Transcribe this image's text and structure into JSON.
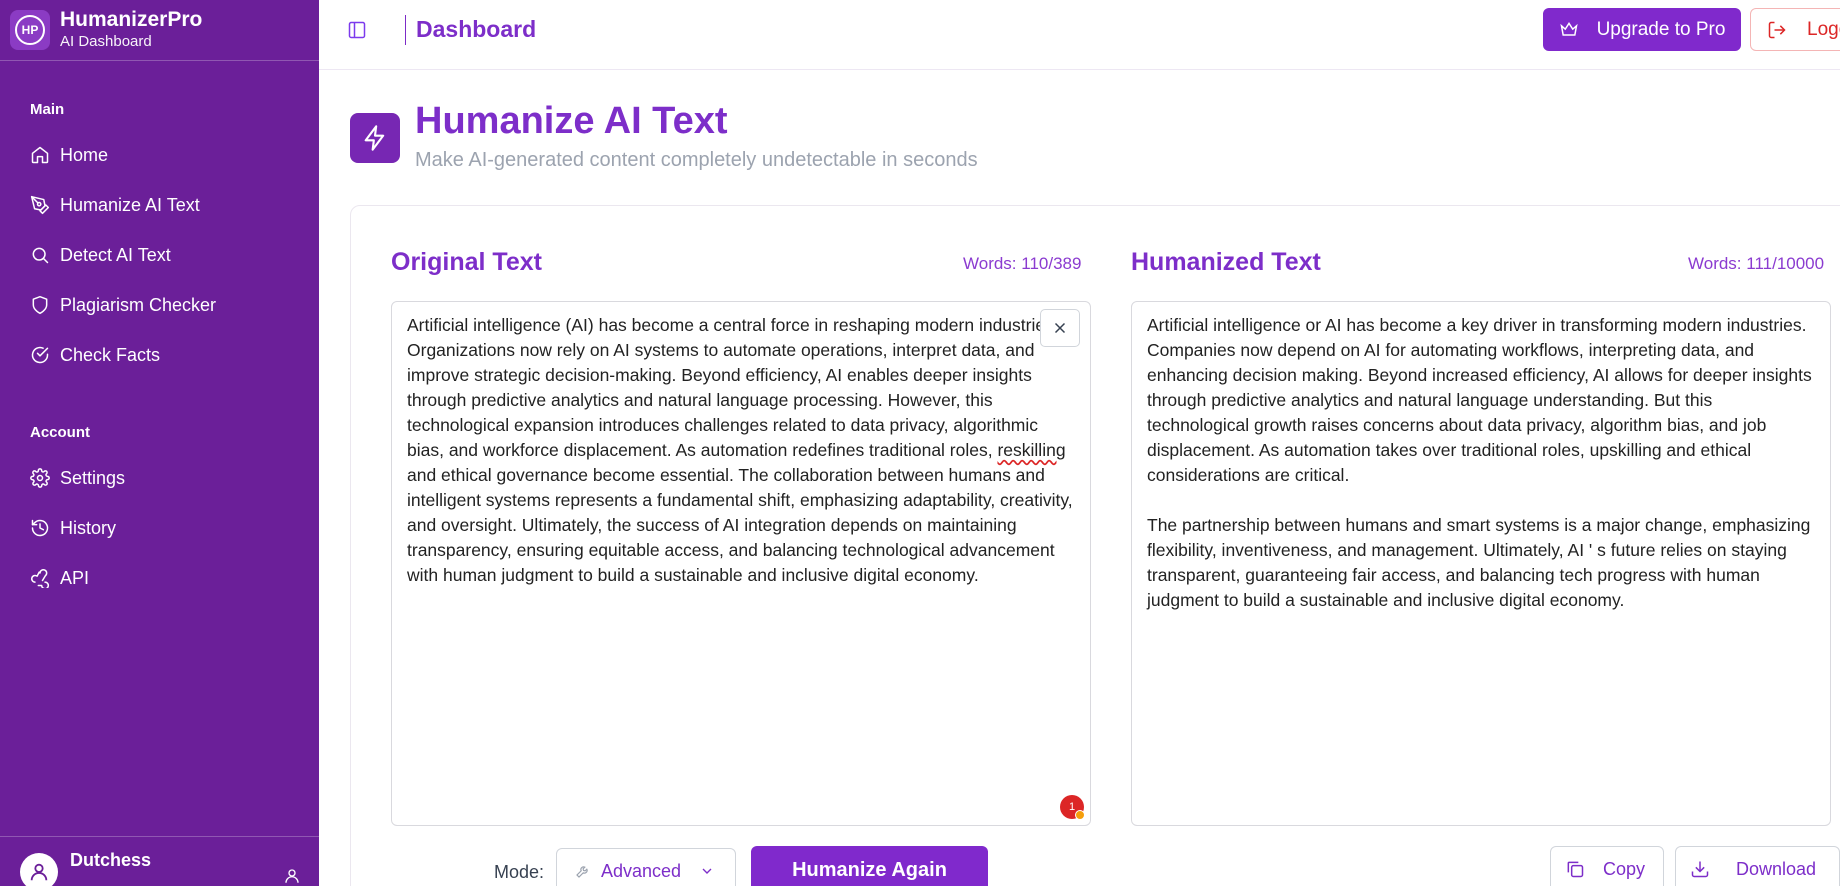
{
  "brand": {
    "logo_initials": "HP",
    "name": "HumanizerPro",
    "subtitle": "AI Dashboard"
  },
  "sidebar": {
    "main_heading": "Main",
    "main_items": [
      {
        "label": "Home",
        "icon": "home-icon"
      },
      {
        "label": "Humanize AI Text",
        "icon": "pen-tool-icon"
      },
      {
        "label": "Detect AI Text",
        "icon": "search-icon"
      },
      {
        "label": "Plagiarism Checker",
        "icon": "shield-icon"
      },
      {
        "label": "Check Facts",
        "icon": "check-circle-icon"
      }
    ],
    "account_heading": "Account",
    "account_items": [
      {
        "label": "Settings",
        "icon": "gear-icon"
      },
      {
        "label": "History",
        "icon": "history-icon"
      },
      {
        "label": "API",
        "icon": "webhook-icon"
      }
    ],
    "user": {
      "name": "Dutchess"
    }
  },
  "header": {
    "title": "Dashboard",
    "upgrade_label": "Upgrade to Pro",
    "logout_label": "Logout"
  },
  "page": {
    "title": "Humanize AI Text",
    "subtitle": "Make AI-generated content completely undetectable in seconds"
  },
  "original": {
    "title": "Original Text",
    "word_count": "Words: 110/389",
    "text_before": "Artificial intelligence (AI) has become a central force in reshaping modern industries. Organizations now rely on AI systems to automate operations, interpret data, and improve strategic decision-making. Beyond efficiency, AI enables deeper insights through predictive analytics and natural language processing. However, this technological expansion introduces challenges related to data privacy, algorithmic bias, and workforce displacement. As automation redefines traditional roles, ",
    "text_flagged": "reskilling",
    "text_after": " and ethical governance become essential. The collaboration between humans and intelligent systems represents a fundamental shift, emphasizing adaptability, creativity, and oversight. Ultimately, the success of AI integration depends on maintaining transparency, ensuring equitable access, and balancing technological advancement with human judgment to build a sustainable and inclusive digital economy.",
    "issue_count": "1"
  },
  "humanized": {
    "title": "Humanized Text",
    "word_count": "Words: 111/10000",
    "paragraph1": "Artificial intelligence or AI has become a key driver in transforming modern industries. Companies now depend on AI for automating workflows, interpreting data, and enhancing decision making. Beyond increased efficiency, AI allows for deeper insights through predictive analytics and natural language understanding. But this technological growth raises concerns about data privacy, algorithm bias, and job displacement. As automation takes over traditional roles, upskilling and ethical considerations are critical.",
    "paragraph2": "The partnership between humans and smart systems is a major change, emphasizing flexibility, inventiveness, and management. Ultimately, AI ' s future relies on staying transparent, guaranteeing fair access, and balancing tech progress with human judgment to build a sustainable and inclusive digital economy."
  },
  "controls": {
    "mode_label": "Mode:",
    "mode_value": "Advanced",
    "humanize_label": "Humanize Again",
    "copy_label": "Copy",
    "download_label": "Download"
  },
  "colors": {
    "sidebar": "#6b1f99",
    "accent": "#8029cc",
    "danger": "#dc2626"
  }
}
